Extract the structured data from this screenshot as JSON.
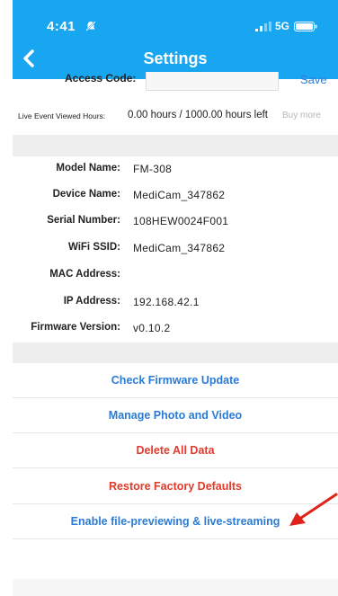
{
  "status": {
    "time": "4:41",
    "network": "5G"
  },
  "header": {
    "title": "Settings"
  },
  "access": {
    "label": "Access Code:",
    "value": "",
    "save_label": "Save"
  },
  "hours": {
    "label": "Live Event Viewed Hours:",
    "value": "0.00 hours / 1000.00 hours left",
    "buy_more": "Buy more"
  },
  "device_info": [
    {
      "label": "Model Name:",
      "value": "FM-308"
    },
    {
      "label": "Device Name:",
      "value": "MediCam_347862"
    },
    {
      "label": "Serial Number:",
      "value": "108HEW0024F001"
    },
    {
      "label": "WiFi SSID:",
      "value": "MediCam_347862"
    },
    {
      "label": "MAC Address:",
      "value": ""
    },
    {
      "label": "IP Address:",
      "value": "192.168.42.1"
    },
    {
      "label": "Firmware Version:",
      "value": "v0.10.2"
    }
  ],
  "actions": [
    {
      "label": "Check Firmware Update",
      "color": "#2b7bd6"
    },
    {
      "label": "Manage Photo and Video",
      "color": "#2b7bd6"
    },
    {
      "label": "Delete All Data",
      "color": "#e13a2a"
    },
    {
      "label": "Restore Factory Defaults",
      "color": "#e13a2a"
    },
    {
      "label": "Enable file-previewing & live-streaming",
      "color": "#2b7bd6"
    }
  ],
  "colors": {
    "header_bg": "#19a6f0",
    "annotation_arrow": "#e0231a"
  }
}
